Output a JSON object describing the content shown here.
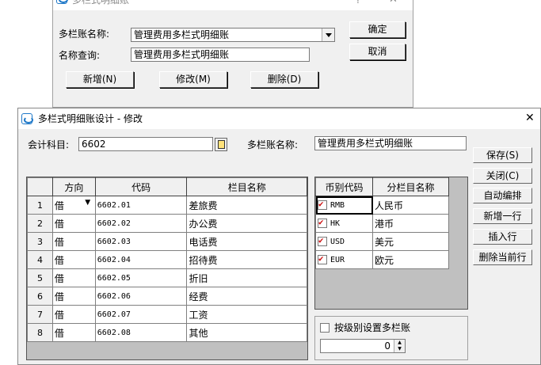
{
  "bg_dialog": {
    "title": "多栏式明细账",
    "help_glyph": "?",
    "close_glyph": "✕",
    "name_label": "多栏账名称:",
    "name_value": "管理费用多栏式明细账",
    "query_label": "名称查询:",
    "query_value": "管理费用多栏式明细账",
    "buttons": {
      "ok": "确定",
      "cancel": "取消",
      "add": "新增(N)",
      "modify": "修改(M)",
      "delete": "删除(D)"
    }
  },
  "main_dialog": {
    "title": "多栏式明细账设计 - 修改",
    "close_glyph": "✕",
    "account_label": "会计科目:",
    "account_value": "6602",
    "name_label": "多栏账名称:",
    "name_value": "管理费用多栏式明细账",
    "side_buttons": [
      "保存(S)",
      "关闭(C)",
      "自动编排",
      "新增一行",
      "插入行",
      "删除当前行"
    ],
    "columns_grid": {
      "headers": [
        "方向",
        "代码",
        "栏目名称"
      ],
      "rows": [
        {
          "num": "1",
          "dir": "借",
          "code": "6602.01",
          "name": "差旅费"
        },
        {
          "num": "2",
          "dir": "借",
          "code": "6602.02",
          "name": "办公费"
        },
        {
          "num": "3",
          "dir": "借",
          "code": "6602.03",
          "name": "电话费"
        },
        {
          "num": "4",
          "dir": "借",
          "code": "6602.04",
          "name": "招待费"
        },
        {
          "num": "5",
          "dir": "借",
          "code": "6602.05",
          "name": "折旧"
        },
        {
          "num": "6",
          "dir": "借",
          "code": "6602.06",
          "name": "经费"
        },
        {
          "num": "7",
          "dir": "借",
          "code": "6602.07",
          "name": "工资"
        },
        {
          "num": "8",
          "dir": "借",
          "code": "6602.08",
          "name": "其他"
        }
      ]
    },
    "currency_grid": {
      "headers": [
        "币别代码",
        "分栏目名称"
      ],
      "rows": [
        {
          "code": "RMB",
          "name": "人民币",
          "checked": true
        },
        {
          "code": "HK",
          "name": "港币",
          "checked": true
        },
        {
          "code": "USD",
          "name": "美元",
          "checked": true
        },
        {
          "code": "EUR",
          "name": "欧元",
          "checked": true
        }
      ]
    },
    "level_checkbox_label": "按级别设置多栏账",
    "level_value": "0"
  }
}
